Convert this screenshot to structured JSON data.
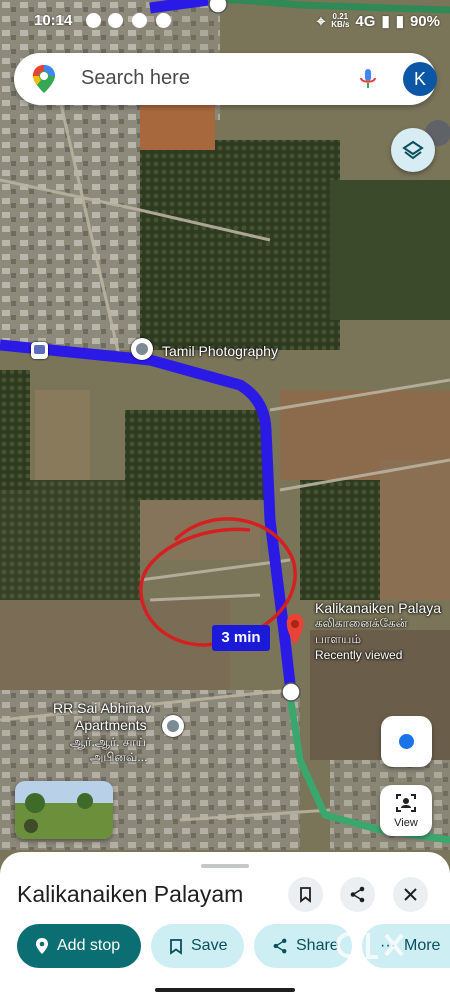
{
  "status": {
    "time": "10:14",
    "speed_value": "0.21",
    "speed_unit": "KB/s",
    "network": "4G",
    "battery": "90%"
  },
  "search": {
    "placeholder": "Search here",
    "avatar_letter": "K"
  },
  "map": {
    "labels": {
      "tamil_photography": "Tamil Photography",
      "rr_apartments_line1": "RR Sai Abhinav",
      "rr_apartments_line2": "Apartments",
      "rr_apartments_tamil": "ஆர்.ஆர். சாய்",
      "rr_apartments_tamil2": "அபினவ்..."
    },
    "destination": {
      "name": "Kalikanaiken Palaya",
      "name_tamil": "கலிகானைக்கேன்",
      "name_tamil2": "பாளயம்",
      "status": "Recently viewed"
    },
    "eta": "3 min",
    "route_color": "#2b19e6",
    "road_color": "#3aa76d",
    "annotation_color": "#d42020"
  },
  "controls": {
    "view_label": "View"
  },
  "sheet": {
    "title": "Kalikanaiken Palayam",
    "buttons": {
      "add_stop": "Add stop",
      "save": "Save",
      "share": "Share",
      "more": "More"
    }
  },
  "icons": {
    "maps_pin": "google-maps-pin-icon",
    "mic": "mic-icon",
    "layers": "layers-icon",
    "bookmark": "bookmark-icon",
    "share": "share-icon",
    "close": "close-icon"
  }
}
